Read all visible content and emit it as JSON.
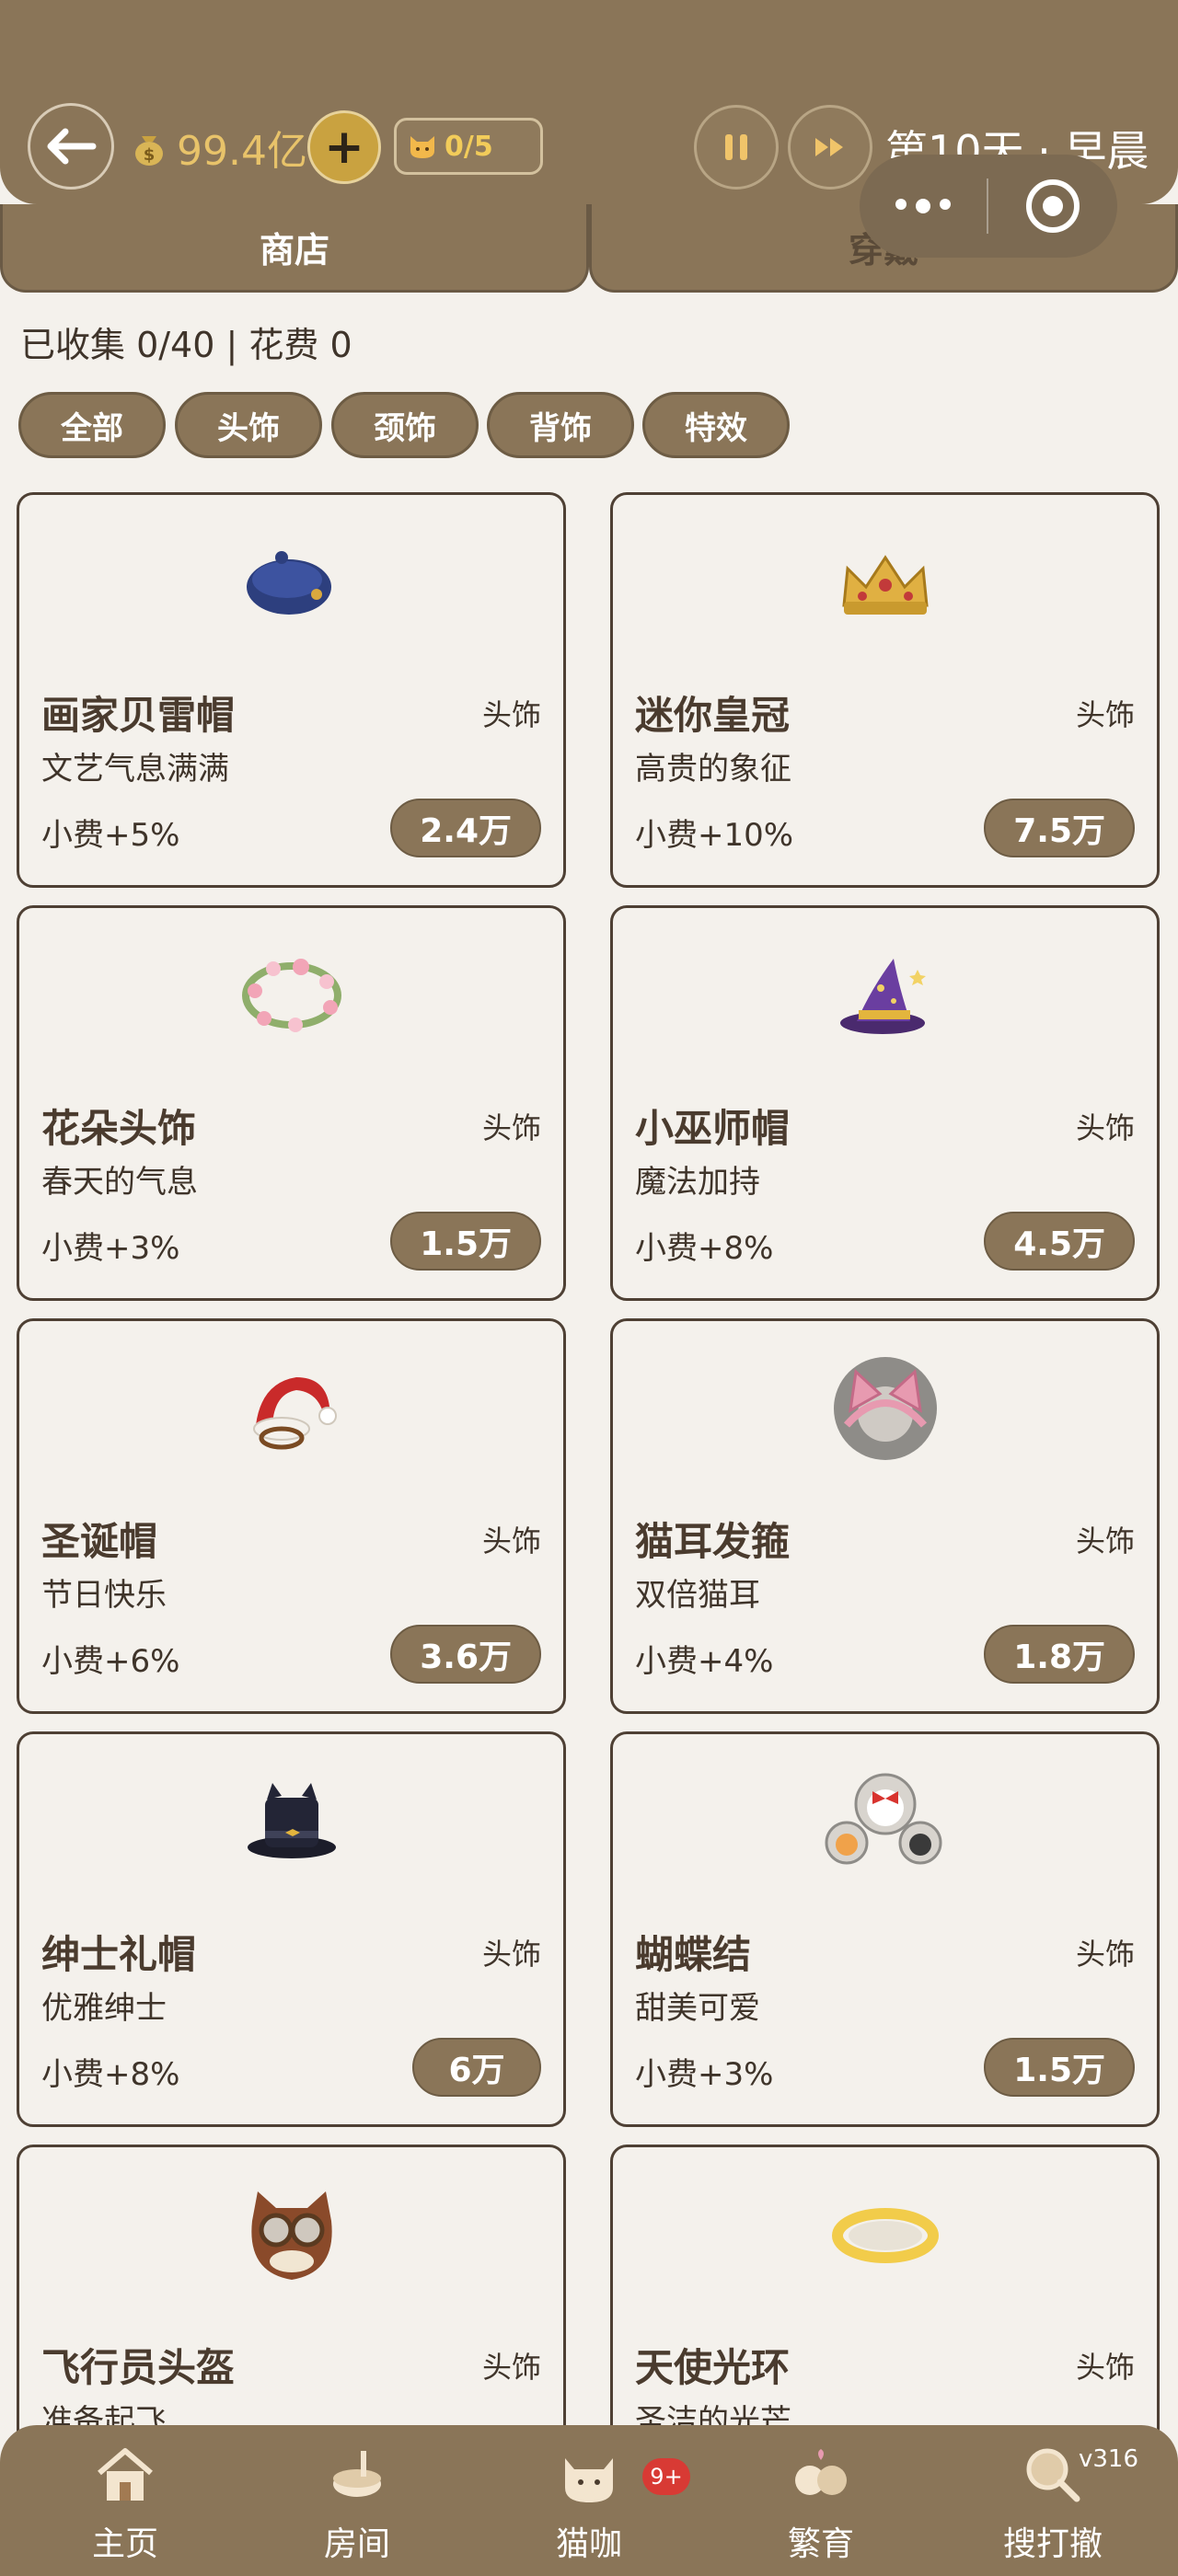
{
  "header": {
    "money": "99.4亿",
    "cat_count": "0/5",
    "day_label": "第10天 · 早晨"
  },
  "tabs": [
    {
      "label": "商店",
      "active": true
    },
    {
      "label": "穿戴",
      "active": false
    }
  ],
  "stats": "已收集 0/40 | 花费 0",
  "filters": [
    "全部",
    "头饰",
    "颈饰",
    "背饰",
    "特效"
  ],
  "items": [
    {
      "name": "画家贝雷帽",
      "category": "头饰",
      "desc": "文艺气息满满",
      "bonus": "小费+5%",
      "price": "2.4万",
      "icon": "beret-icon"
    },
    {
      "name": "迷你皇冠",
      "category": "头饰",
      "desc": "高贵的象征",
      "bonus": "小费+10%",
      "price": "7.5万",
      "icon": "crown-icon"
    },
    {
      "name": "花朵头饰",
      "category": "头饰",
      "desc": "春天的气息",
      "bonus": "小费+3%",
      "price": "1.5万",
      "icon": "flower-wreath-icon"
    },
    {
      "name": "小巫师帽",
      "category": "头饰",
      "desc": "魔法加持",
      "bonus": "小费+8%",
      "price": "4.5万",
      "icon": "wizard-hat-icon"
    },
    {
      "name": "圣诞帽",
      "category": "头饰",
      "desc": "节日快乐",
      "bonus": "小费+6%",
      "price": "3.6万",
      "icon": "santa-hat-icon"
    },
    {
      "name": "猫耳发箍",
      "category": "头饰",
      "desc": "双倍猫耳",
      "bonus": "小费+4%",
      "price": "1.8万",
      "icon": "cat-ear-headband-icon"
    },
    {
      "name": "绅士礼帽",
      "category": "头饰",
      "desc": "优雅绅士",
      "bonus": "小费+8%",
      "price": "6万",
      "icon": "top-hat-icon"
    },
    {
      "name": "蝴蝶结",
      "category": "头饰",
      "desc": "甜美可爱",
      "bonus": "小费+3%",
      "price": "1.5万",
      "icon": "bow-icon"
    },
    {
      "name": "飞行员头盔",
      "category": "头饰",
      "desc": "准备起飞",
      "bonus": "",
      "price": "",
      "icon": "pilot-helmet-icon"
    },
    {
      "name": "天使光环",
      "category": "头饰",
      "desc": "圣洁的光芒",
      "bonus": "",
      "price": "",
      "icon": "halo-icon"
    }
  ],
  "bottom_nav": [
    {
      "label": "主页",
      "icon": "house-icon"
    },
    {
      "label": "房间",
      "icon": "room-icon"
    },
    {
      "label": "猫咖",
      "icon": "cat-cafe-icon",
      "badge": "9+"
    },
    {
      "label": "繁育",
      "icon": "breeding-icon"
    },
    {
      "label": "搜打撤",
      "icon": "search-loot-icon",
      "version": "v316"
    }
  ],
  "colors": {
    "bar": "#8a7558",
    "background": "#f4f1ec",
    "gold": "#c9a240",
    "badge": "#d83a34"
  }
}
